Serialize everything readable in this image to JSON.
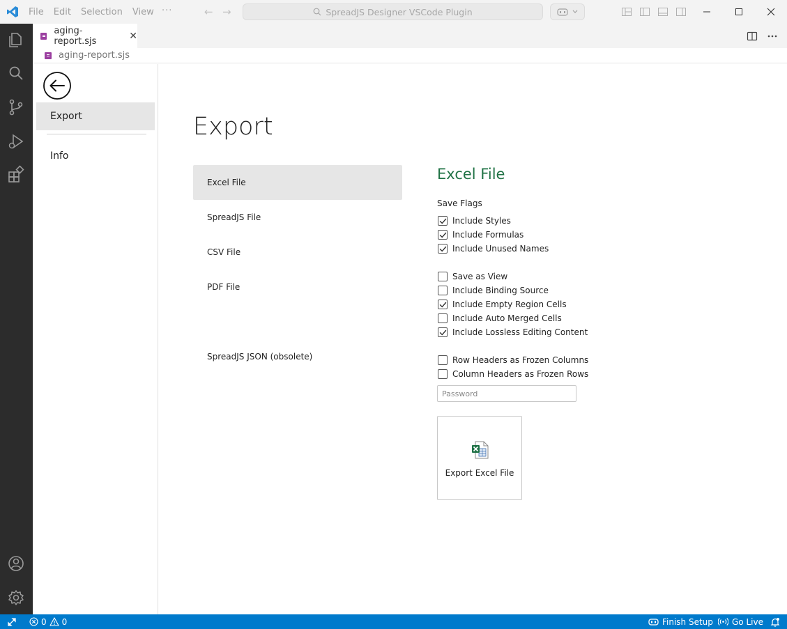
{
  "titlebar": {
    "menu": [
      "File",
      "Edit",
      "Selection",
      "View"
    ],
    "more": "···",
    "search_text": "SpreadJS Designer VSCode Plugin"
  },
  "tab": {
    "label": "aging-report.sjs",
    "close": "✕"
  },
  "breadcrumb": {
    "file": "aging-report.sjs"
  },
  "sidebar_nav": {
    "items": [
      "Export",
      "Info"
    ]
  },
  "export_page": {
    "title": "Export",
    "types": [
      "Excel File",
      "SpreadJS File",
      "CSV File",
      "PDF File",
      "SpreadJS JSON (obsolete)"
    ],
    "selected_type": "Excel File",
    "section_title": "Excel File",
    "flags_label": "Save Flags",
    "checkboxes": [
      {
        "label": "Include Styles",
        "checked": true
      },
      {
        "label": "Include Formulas",
        "checked": true
      },
      {
        "label": "Include Unused Names",
        "checked": true
      },
      {
        "label": "Save as View",
        "checked": false
      },
      {
        "label": "Include Binding Source",
        "checked": false
      },
      {
        "label": "Include Empty Region Cells",
        "checked": true
      },
      {
        "label": "Include Auto Merged Cells",
        "checked": false
      },
      {
        "label": "Include Lossless Editing Content",
        "checked": true
      },
      {
        "label": "Row Headers as Frozen Columns",
        "checked": false
      },
      {
        "label": "Column Headers as Frozen Rows",
        "checked": false
      }
    ],
    "password_placeholder": "Password",
    "export_button": "Export Excel File"
  },
  "statusbar": {
    "errors": "0",
    "warnings": "0",
    "finish_setup": "Finish Setup",
    "go_live": "Go Live"
  },
  "colors": {
    "excel_green": "#217346",
    "status_blue": "#007acc",
    "activity_bar": "#2c2c2c"
  }
}
